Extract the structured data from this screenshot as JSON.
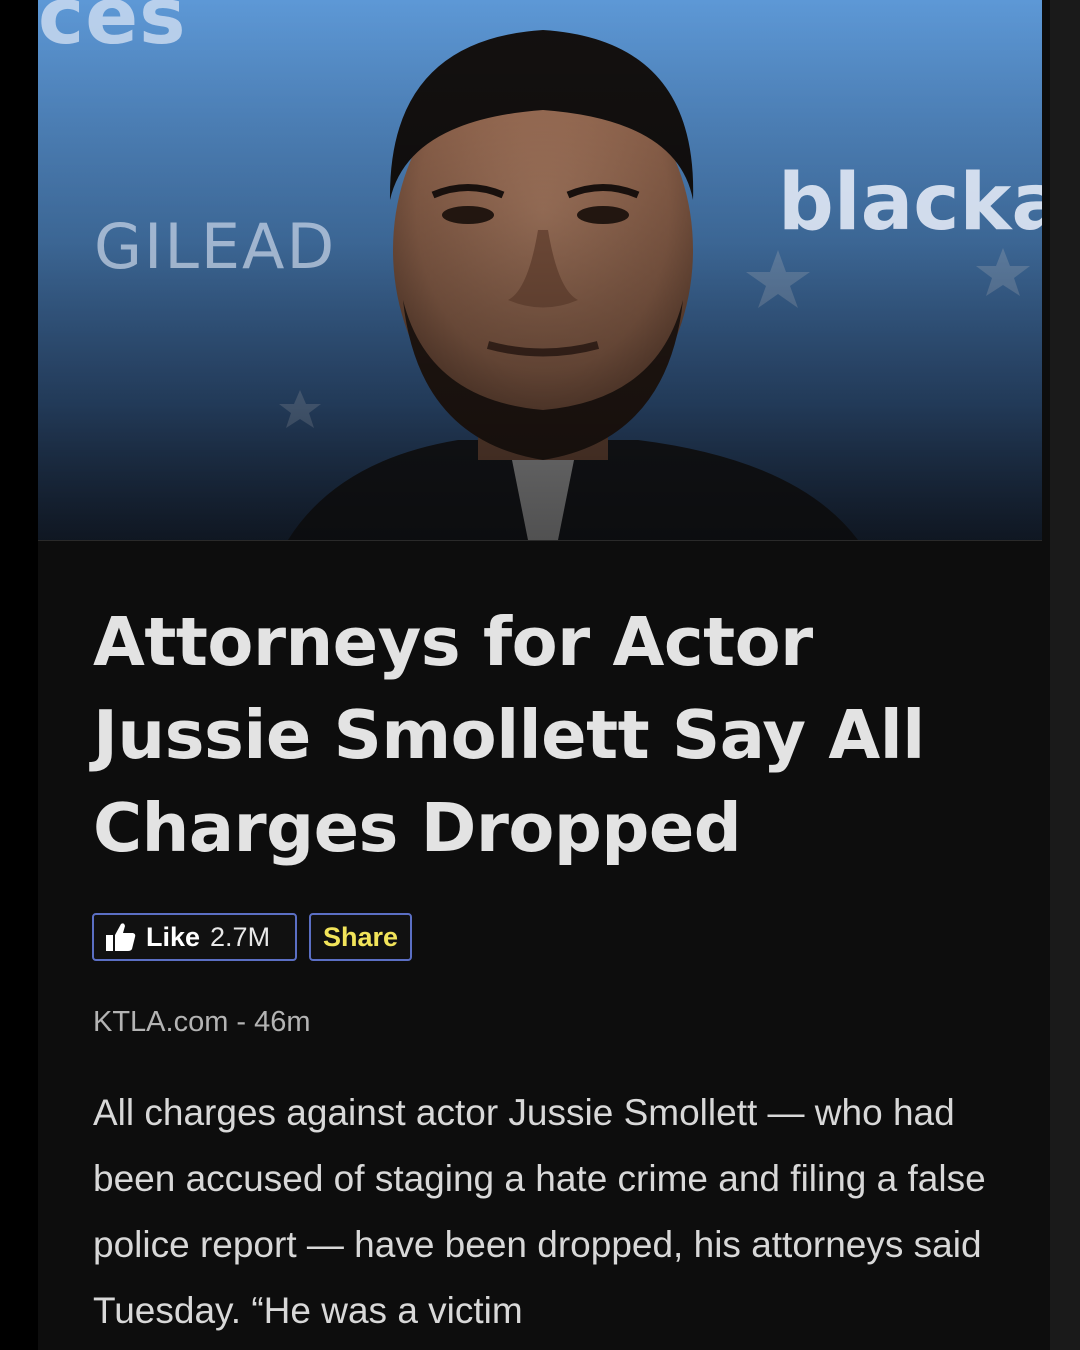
{
  "hero": {
    "watermark_top": "ces",
    "watermark_left": "GILEAD",
    "watermark_right": "blacka"
  },
  "article": {
    "headline": "Attorneys for Actor Jussie Smollett Say All Charges Dropped",
    "source": "KTLA.com",
    "separator": " - ",
    "age": "46m",
    "body": "All charges against actor Jussie Smollett — who had been accused of staging a hate crime and filing a false police report — have been dropped, his attorneys said Tuesday. “He was a victim"
  },
  "actions": {
    "like_label": "Like",
    "like_count": "2.7M",
    "share_label": "Share"
  },
  "colors": {
    "background": "#0d0d0d",
    "headline": "#e3e3e3",
    "button_border": "#5b6fc4",
    "share_text": "#f2e45a"
  },
  "icons": {
    "like": "thumbs-up-icon"
  }
}
